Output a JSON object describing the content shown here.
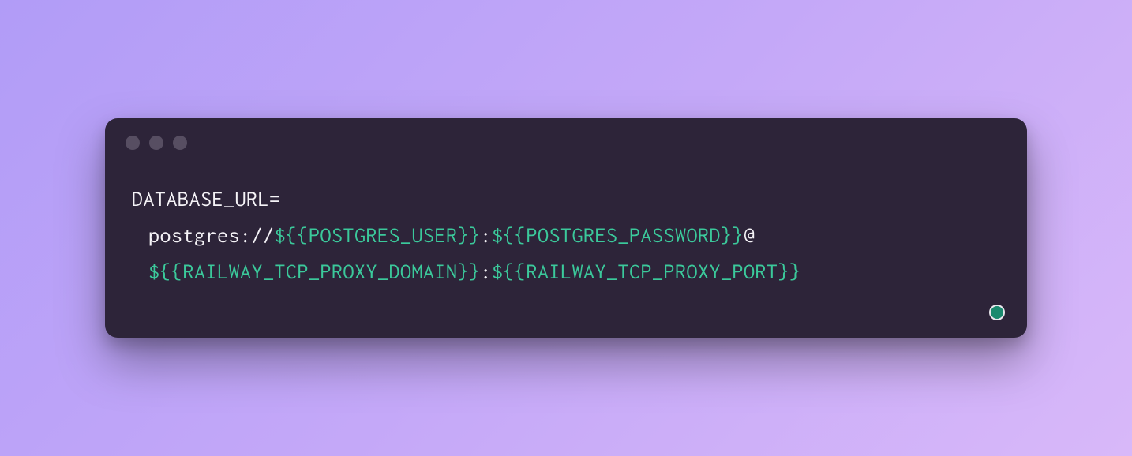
{
  "code": {
    "var_name": "DATABASE_URL",
    "equals": "=",
    "protocol": "postgres://",
    "var_user": "${{POSTGRES_USER}}",
    "colon1": ":",
    "var_password": "${{POSTGRES_PASSWORD}}",
    "at": "@",
    "var_domain": "${{RAILWAY_TCP_PROXY_DOMAIN}}",
    "colon2": ":",
    "var_port": "${{RAILWAY_TCP_PROXY_PORT}}"
  },
  "colors": {
    "terminal_bg": "#2d2439",
    "text_white": "#f5f3f7",
    "text_green": "#3bc99b",
    "traffic_light": "#574e62",
    "status_dot_fill": "#1a8a6e",
    "status_dot_border": "#e8e6ec",
    "gradient_start": "#b19cf7",
    "gradient_end": "#d8b8f9"
  }
}
